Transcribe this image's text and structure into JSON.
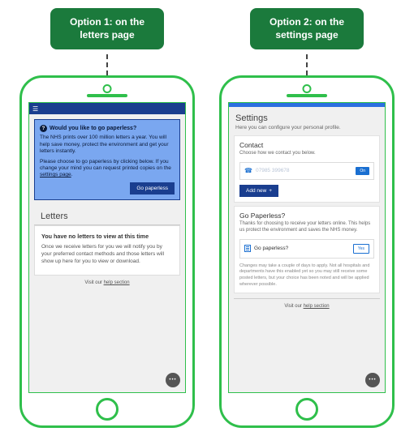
{
  "options": {
    "opt1": {
      "title": "Option 1: on the letters page"
    },
    "opt2": {
      "title": "Option 2: on the settings page"
    }
  },
  "opt1": {
    "banner": {
      "title": "Would you like to go paperless?",
      "p1": "The NHS prints over 100 million letters a year. You will help save money, protect the environment and get your letters instantly.",
      "p2a": "Please choose to go paperless by clicking below. If you change your mind you can request printed copies on the ",
      "link": "settings page",
      "p2b": ".",
      "button": "Go paperless"
    },
    "letters": {
      "heading": "Letters",
      "empty_title": "You have no letters to view at this time",
      "empty_body": "Once we receive letters for you we will notify you by your preferred contact methods and those letters will show up here for you to view or download."
    },
    "help_prefix": "Visit our ",
    "help_link": "help section"
  },
  "opt2": {
    "settings": {
      "heading": "Settings",
      "sub": "Here you can configure your personal profile."
    },
    "contact": {
      "title": "Contact",
      "sub": "Choose how we contact you below.",
      "number": "07985 399678",
      "toggle": "On",
      "add": "Add new"
    },
    "gp": {
      "title": "Go Paperless?",
      "sub": "Thanks for choosing to receive your letters online. This helps us protect the environment and saves the NHS money.",
      "row_label": "Go paperless?",
      "toggle": "Yes",
      "note": "Changes may take a couple of days to apply. Not all hospitals and departments have this enabled yet so you may still receive some posted letters, but your choice has been noted and will be applied wherever possible."
    },
    "help_prefix": "Visit our ",
    "help_link": "help section"
  }
}
